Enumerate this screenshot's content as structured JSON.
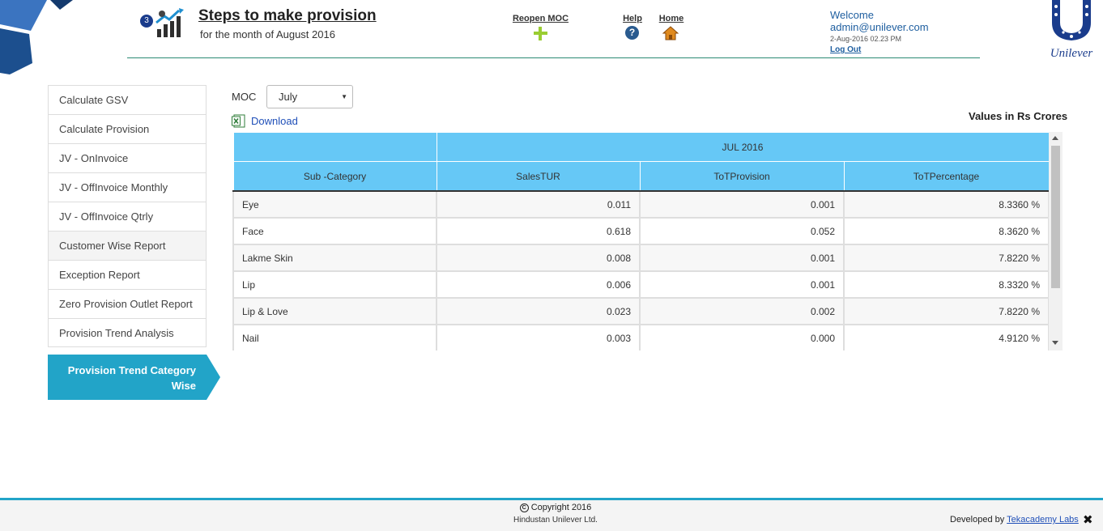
{
  "header": {
    "step_number": "3",
    "title": "Steps to make provision",
    "subtitle": "for the month of August 2016",
    "reopen_moc": "Reopen MOC",
    "help": "Help",
    "help_symbol": "?",
    "home": "Home",
    "welcome": "Welcome",
    "user_email": "admin@unilever.com",
    "login_time": "2-Aug-2016 02.23 PM",
    "logout": "Log Out",
    "brand": "Unilever"
  },
  "sidebar": {
    "items": [
      {
        "label": "Calculate GSV"
      },
      {
        "label": "Calculate Provision"
      },
      {
        "label": "JV - OnInvoice"
      },
      {
        "label": "JV - OffInvoice Monthly"
      },
      {
        "label": "JV - OffInvoice Qtrly"
      },
      {
        "label": "Customer Wise Report"
      },
      {
        "label": "Exception Report"
      },
      {
        "label": "Zero Provision Outlet Report"
      },
      {
        "label": "Provision Trend Analysis"
      }
    ],
    "active_item": "Provision Trend Category Wise"
  },
  "filters": {
    "moc_label": "MOC",
    "moc_value": "July",
    "download": "Download",
    "values_note": "Values in Rs Crores"
  },
  "table": {
    "period": "JUL 2016",
    "columns": [
      "Sub -Category",
      "SalesTUR",
      "ToTProvision",
      "ToTPercentage"
    ],
    "rows": [
      {
        "sub_category": "Eye",
        "sales_tur": "0.011",
        "tot_provision": "0.001",
        "tot_percentage": "8.3360 %"
      },
      {
        "sub_category": "Face",
        "sales_tur": "0.618",
        "tot_provision": "0.052",
        "tot_percentage": "8.3620 %"
      },
      {
        "sub_category": "Lakme Skin",
        "sales_tur": "0.008",
        "tot_provision": "0.001",
        "tot_percentage": "7.8220 %"
      },
      {
        "sub_category": "Lip",
        "sales_tur": "0.006",
        "tot_provision": "0.001",
        "tot_percentage": "8.3320 %"
      },
      {
        "sub_category": "Lip & Love",
        "sales_tur": "0.023",
        "tot_provision": "0.002",
        "tot_percentage": "7.8220 %"
      },
      {
        "sub_category": "Nail",
        "sales_tur": "0.003",
        "tot_provision": "0.000",
        "tot_percentage": "4.9120 %"
      }
    ]
  },
  "footer": {
    "copyright": "Copyright 2016",
    "copyright_symbol": "C",
    "company": "Hindustan Unilever Ltd.",
    "developed_by": "Developed by",
    "developer": "Tekacademy Labs",
    "close_symbol": "✖"
  },
  "colors": {
    "accent": "#22a4c8",
    "table_header": "#66c8f6",
    "link": "#1f4fb8",
    "brand_blue": "#1a3c8c",
    "divider": "#2b8a74"
  },
  "icons": {
    "step_badge": "circle-number-icon",
    "header": "chart-growth-icon",
    "reopen": "plus-icon",
    "help": "question-icon",
    "home": "home-icon",
    "excel": "excel-icon",
    "close": "close-icon"
  }
}
